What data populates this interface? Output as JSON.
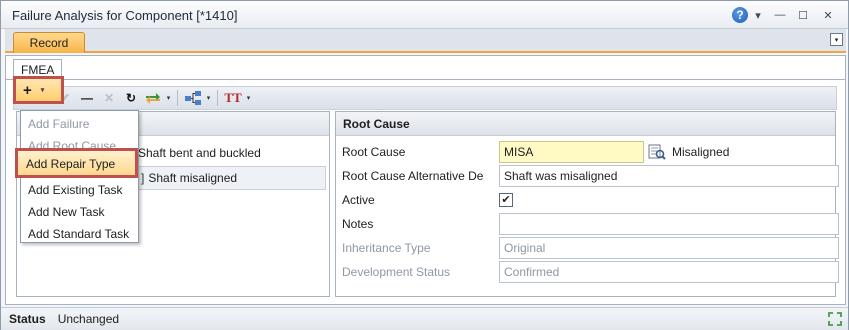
{
  "window": {
    "title": "Failure Analysis for Component [*1410]",
    "controls": {
      "help_glyph": "?",
      "help_caret": "▾",
      "minimize": "—",
      "maximize": "☐",
      "close": "✕"
    }
  },
  "tabs": {
    "record_label": "Record",
    "strip_menu_glyph": "▾",
    "sub_tab_label": "FMEA"
  },
  "toolbar": {
    "add_glyph": "+",
    "caret": "▾",
    "confirm_glyph": "✔",
    "remove_glyph": "—",
    "cancel_glyph": "✕",
    "refresh_glyph": "↻",
    "text_glyph": "TT",
    "icons": [
      "add-icon",
      "check-icon",
      "minus-icon",
      "cancel-icon",
      "refresh-icon",
      "swap-icon",
      "hierarchy-icon",
      "text-format-icon"
    ]
  },
  "add_menu": {
    "items": [
      {
        "label": "Add Failure",
        "enabled": false
      },
      {
        "label": "Add Root Cause",
        "enabled": false
      },
      {
        "label": "Add Repair Type",
        "enabled": true,
        "highlighted": true
      },
      {
        "label": "Add Existing Task",
        "enabled": true
      },
      {
        "label": "Add New Task",
        "enabled": true
      },
      {
        "label": "Add Standard Task",
        "enabled": true
      }
    ]
  },
  "tree": {
    "rows": [
      {
        "text": "Shaft bent and buckled"
      },
      {
        "text": "Shaft misaligned",
        "selected": true
      }
    ]
  },
  "root_cause": {
    "header": "Root Cause",
    "fields": {
      "root_cause": {
        "label": "Root Cause",
        "value": "MISA",
        "lookup_text": "Misaligned"
      },
      "alternative": {
        "label": "Root Cause Alternative De",
        "value": "Shaft was misaligned"
      },
      "active": {
        "label": "Active",
        "checked": true,
        "glyph": "✔"
      },
      "notes": {
        "label": "Notes",
        "value": ""
      },
      "inheritance": {
        "label": "Inheritance Type",
        "value": "Original"
      },
      "development": {
        "label": "Development Status",
        "value": "Confirmed"
      }
    }
  },
  "status": {
    "label": "Status",
    "value": "Unchanged"
  },
  "colors": {
    "accent_orange": "#f8b447",
    "highlight_red": "#c0504d",
    "lookup_yellow": "#fff9c4"
  }
}
